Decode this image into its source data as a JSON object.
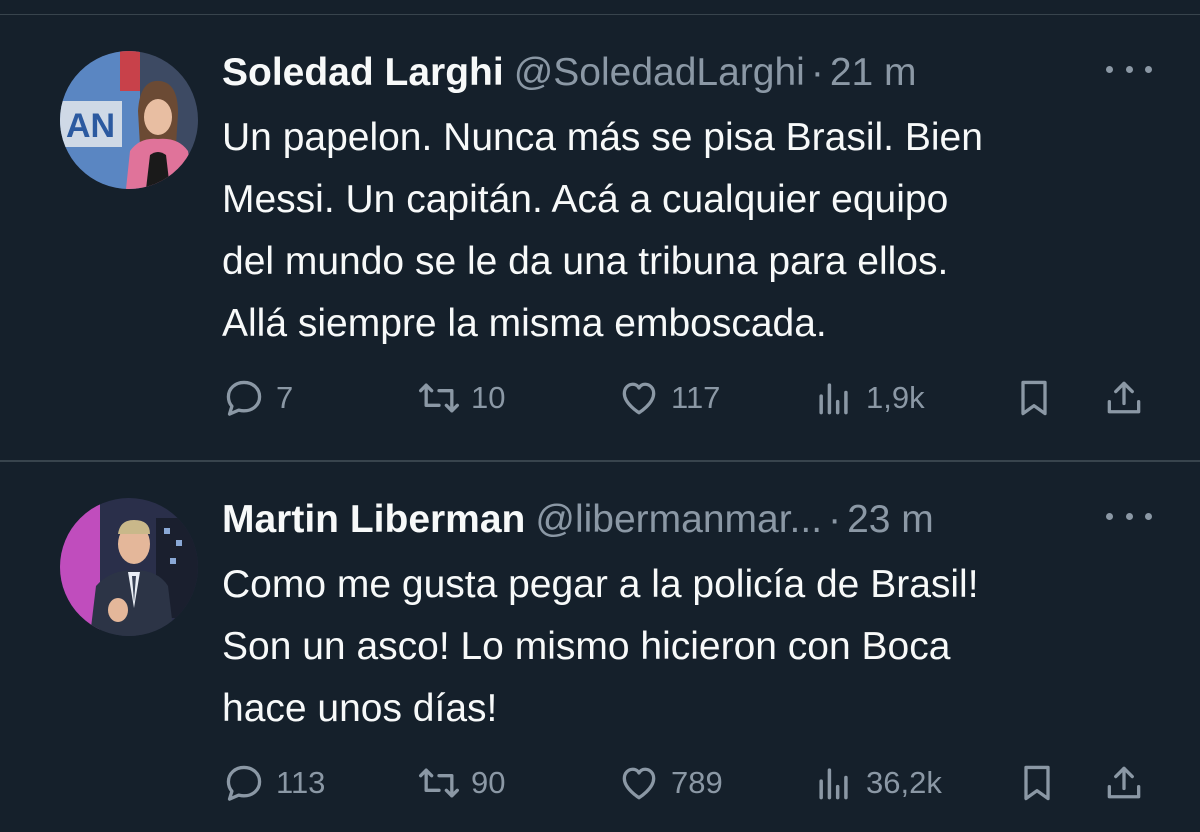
{
  "colors": {
    "background": "#15202b",
    "divider": "#38444d",
    "secondary_text": "#8b98a5",
    "primary_text": "#f7f9f9"
  },
  "tweets": [
    {
      "name": "Soledad Larghi",
      "handle": "@SoledadLarghi",
      "separator": "·",
      "time": "21 m",
      "avatar_label": "AN",
      "text_lines": [
        "Un papelon. Nunca más se pisa Brasil. Bien",
        "Messi. Un capitán. Acá a cualquier equipo",
        "del mundo se le da una tribuna para ellos.",
        "Allá siempre la misma emboscada."
      ],
      "replies": "7",
      "retweets": "10",
      "likes": "117",
      "views": "1,9k"
    },
    {
      "name": "Martin Liberman",
      "handle": "@libermanmar...",
      "separator": "·",
      "time": "23 m",
      "text_lines": [
        "Como me gusta pegar a la policía de Brasil!",
        "Son un asco! Lo mismo hicieron con Boca",
        "hace unos días!"
      ],
      "replies": "113",
      "retweets": "90",
      "likes": "789",
      "views": "36,2k"
    }
  ],
  "icons": [
    "more-icon",
    "reply-icon",
    "retweet-icon",
    "like-icon",
    "views-icon",
    "bookmark-icon",
    "share-icon"
  ]
}
